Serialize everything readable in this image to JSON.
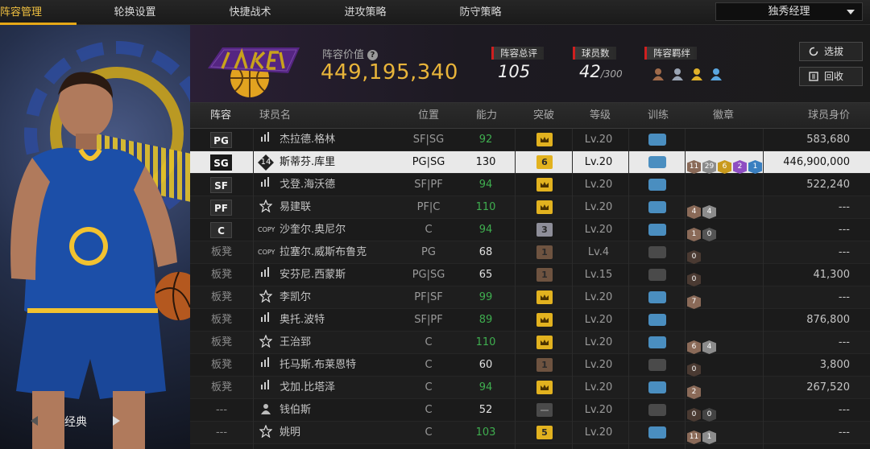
{
  "nav": {
    "tabs": [
      "阵容管理",
      "轮换设置",
      "快捷战术",
      "进攻策略",
      "防守策略"
    ],
    "mode_select": "独秀经理"
  },
  "left_panel": {
    "caption": "经典"
  },
  "header": {
    "team_value_label": "阵容价值",
    "team_value": "449,195,340",
    "rating_label": "阵容总评",
    "rating_value": "105",
    "players_label": "球员数",
    "players_value": "42",
    "players_max": "/300",
    "bond_label": "阵容羁绊",
    "btn_scout": "选拔",
    "btn_recycle": "回收"
  },
  "table": {
    "columns": [
      "阵容",
      "球员名",
      "位置",
      "能力",
      "突破",
      "等级",
      "训练",
      "徽章",
      "球员身价"
    ],
    "rows": [
      {
        "pos": "PG",
        "bench": false,
        "icon": "bars",
        "name": "杰拉德.格林",
        "pp": "SF|SG",
        "ability": "92",
        "abil_color": "green",
        "brk": "crown",
        "brk_color": "#e2b21f",
        "lv": "Lv.20",
        "train": "#4a8ec0",
        "badges": [],
        "value": "583,680",
        "selected": false
      },
      {
        "pos": "SG",
        "bench": false,
        "icon": "14",
        "name": "斯蒂芬.库里",
        "pp": "PG|SG",
        "ability": "130",
        "abil_color": "white",
        "brk": "6",
        "brk_color": "#e2b21f",
        "lv": "Lv.20",
        "train": "#4a8ec0",
        "badges": [
          {
            "t": "11",
            "c": "#8a6a58"
          },
          {
            "t": "29",
            "c": "#8c8c8c"
          },
          {
            "t": "6",
            "c": "#c99a1c"
          },
          {
            "t": "2",
            "c": "#8e4ec2"
          },
          {
            "t": "1",
            "c": "#3a7fc0"
          }
        ],
        "value": "446,900,000",
        "selected": true
      },
      {
        "pos": "SF",
        "bench": false,
        "icon": "bars",
        "name": "戈登.海沃德",
        "pp": "SF|PF",
        "ability": "94",
        "abil_color": "green",
        "brk": "crown",
        "brk_color": "#e2b21f",
        "lv": "Lv.20",
        "train": "#4a8ec0",
        "badges": [],
        "value": "522,240",
        "selected": false
      },
      {
        "pos": "PF",
        "bench": false,
        "icon": "star",
        "name": "易建联",
        "pp": "PF|C",
        "ability": "110",
        "abil_color": "green",
        "brk": "crown",
        "brk_color": "#e2b21f",
        "lv": "Lv.20",
        "train": "#4a8ec0",
        "badges": [
          {
            "t": "4",
            "c": "#8a6a58"
          },
          {
            "t": "4",
            "c": "#8c8c8c"
          }
        ],
        "value": "---",
        "selected": false
      },
      {
        "pos": "C",
        "bench": false,
        "icon": "COPY",
        "name": "沙奎尔.奥尼尔",
        "pp": "C",
        "ability": "94",
        "abil_color": "green",
        "brk": "3",
        "brk_color": "#8e8e99",
        "lv": "Lv.20",
        "train": "#4a8ec0",
        "badges": [
          {
            "t": "1",
            "c": "#8a6a58"
          },
          {
            "t": "0",
            "c": "#555"
          }
        ],
        "value": "---",
        "selected": false
      },
      {
        "pos": "板凳",
        "bench": true,
        "icon": "COPY",
        "name": "拉塞尔.威斯布鲁克",
        "pp": "PG",
        "ability": "68",
        "abil_color": "white",
        "brk": "1",
        "brk_color": "#6e5340",
        "lv": "Lv.4",
        "train": "#4a4a4a",
        "badges": [
          {
            "t": "0",
            "c": "#4a3a32"
          }
        ],
        "value": "---",
        "selected": false
      },
      {
        "pos": "板凳",
        "bench": true,
        "icon": "bars",
        "name": "安芬尼.西蒙斯",
        "pp": "PG|SG",
        "ability": "65",
        "abil_color": "white",
        "brk": "1",
        "brk_color": "#6e5340",
        "lv": "Lv.15",
        "train": "#4a4a4a",
        "badges": [
          {
            "t": "0",
            "c": "#4a3a32"
          }
        ],
        "value": "41,300",
        "selected": false
      },
      {
        "pos": "板凳",
        "bench": true,
        "icon": "star",
        "name": "李凯尔",
        "pp": "PF|SF",
        "ability": "99",
        "abil_color": "green",
        "brk": "crown",
        "brk_color": "#e2b21f",
        "lv": "Lv.20",
        "train": "#4a8ec0",
        "badges": [
          {
            "t": "7",
            "c": "#8a6a58"
          }
        ],
        "value": "---",
        "selected": false
      },
      {
        "pos": "板凳",
        "bench": true,
        "icon": "bars",
        "name": "奥托.波特",
        "pp": "SF|PF",
        "ability": "89",
        "abil_color": "green",
        "brk": "crown",
        "brk_color": "#e2b21f",
        "lv": "Lv.20",
        "train": "#4a8ec0",
        "badges": [],
        "value": "876,800",
        "selected": false
      },
      {
        "pos": "板凳",
        "bench": true,
        "icon": "star",
        "name": "王治郅",
        "pp": "C",
        "ability": "110",
        "abil_color": "green",
        "brk": "crown",
        "brk_color": "#e2b21f",
        "lv": "Lv.20",
        "train": "#4a8ec0",
        "badges": [
          {
            "t": "6",
            "c": "#8a6a58"
          },
          {
            "t": "4",
            "c": "#8c8c8c"
          }
        ],
        "value": "---",
        "selected": false
      },
      {
        "pos": "板凳",
        "bench": true,
        "icon": "bars",
        "name": "托马斯.布莱恩特",
        "pp": "C",
        "ability": "60",
        "abil_color": "white",
        "brk": "1",
        "brk_color": "#6e5340",
        "lv": "Lv.20",
        "train": "#4a4a4a",
        "badges": [
          {
            "t": "0",
            "c": "#4a3a32"
          }
        ],
        "value": "3,800",
        "selected": false
      },
      {
        "pos": "板凳",
        "bench": true,
        "icon": "bars",
        "name": "戈加.比塔泽",
        "pp": "C",
        "ability": "94",
        "abil_color": "green",
        "brk": "crown",
        "brk_color": "#e2b21f",
        "lv": "Lv.20",
        "train": "#4a8ec0",
        "badges": [
          {
            "t": "2",
            "c": "#8a6a58"
          }
        ],
        "value": "267,520",
        "selected": false
      },
      {
        "pos": "---",
        "bench": true,
        "icon": "person",
        "name": "钱伯斯",
        "pp": "C",
        "ability": "52",
        "abil_color": "white",
        "brk": "dash",
        "brk_color": "#4a4a4a",
        "lv": "Lv.20",
        "train": "#4a4a4a",
        "badges": [
          {
            "t": "0",
            "c": "#4a3a32"
          },
          {
            "t": "0",
            "c": "#444"
          }
        ],
        "value": "---",
        "selected": false
      },
      {
        "pos": "---",
        "bench": true,
        "icon": "star",
        "name": "姚明",
        "pp": "C",
        "ability": "103",
        "abil_color": "green",
        "brk": "5",
        "brk_color": "#e2b21f",
        "lv": "Lv.20",
        "train": "#4a8ec0",
        "badges": [
          {
            "t": "11",
            "c": "#8a6a58"
          },
          {
            "t": "1",
            "c": "#8c8c8c"
          }
        ],
        "value": "---",
        "selected": false
      }
    ]
  }
}
